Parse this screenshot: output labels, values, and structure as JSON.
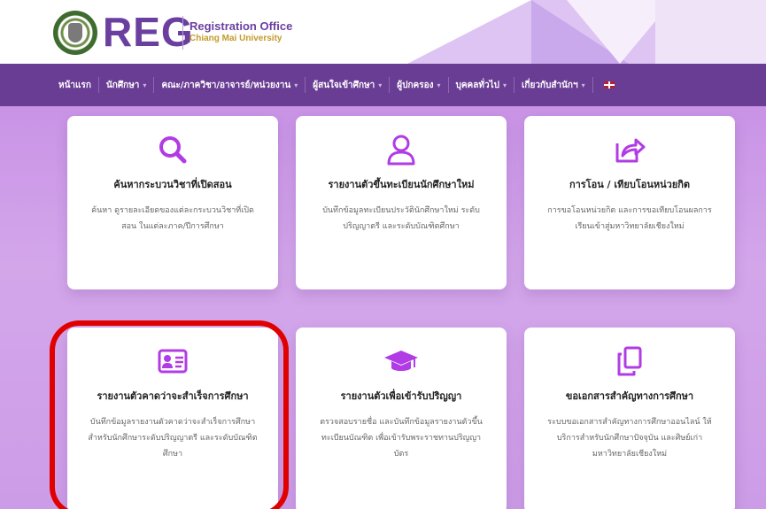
{
  "brand": {
    "logo_text": "REG",
    "subtitle1": "Registration Office",
    "subtitle2": "Chiang Mai University"
  },
  "nav": {
    "items": [
      {
        "label": "หน้าแรก",
        "has_caret": false
      },
      {
        "label": "นักศึกษา",
        "has_caret": true
      },
      {
        "label": "คณะ/ภาควิชา/อาจารย์/หน่วยงาน",
        "has_caret": true
      },
      {
        "label": "ผู้สนใจเข้าศึกษา",
        "has_caret": true
      },
      {
        "label": "ผู้ปกครอง",
        "has_caret": true
      },
      {
        "label": "บุคคลทั่วไป",
        "has_caret": true
      },
      {
        "label": "เกี่ยวกับสำนักฯ",
        "has_caret": true
      }
    ],
    "caret_glyph": "▾",
    "language_icon": "uk-flag-icon"
  },
  "cards": [
    {
      "icon": "search-icon",
      "title": "ค้นหากระบวนวิชาที่เปิดสอน",
      "desc": "ค้นหา ดูรายละเอียดของแต่ละกระบวนวิชาที่เปิดสอน ในแต่ละภาค/ปีการศึกษา"
    },
    {
      "icon": "user-icon",
      "title": "รายงานตัวขึ้นทะเบียนนักศึกษาใหม่",
      "desc": "บันทึกข้อมูลทะเบียนประวัตินักศึกษาใหม่ ระดับปริญญาตรี และระดับบัณฑิตศึกษา"
    },
    {
      "icon": "share-icon",
      "title": "การโอน / เทียบโอนหน่วยกิต",
      "desc": "การขอโอนหน่วยกิต และการขอเทียบโอนผลการเรียนเข้าสู่มหาวิทยาลัยเชียงใหม่"
    },
    {
      "icon": "id-card-icon",
      "title": "รายงานตัวคาดว่าจะสำเร็จการศึกษา",
      "desc": "บันทึกข้อมูลรายงานตัวคาดว่าจะสำเร็จการศึกษา สำหรับนักศึกษาระดับปริญญาตรี และระดับบัณฑิตศึกษา"
    },
    {
      "icon": "graduation-cap-icon",
      "title": "รายงานตัวเพื่อเข้ารับปริญญา",
      "desc": "ตรวจสอบรายชื่อ และบันทึกข้อมูลรายงานตัวขึ้นทะเบียนบัณฑิต เพื่อเข้ารับพระราชทานปริญญาบัตร"
    },
    {
      "icon": "copy-icon",
      "title": "ขอเอกสารสำคัญทางการศึกษา",
      "desc": "ระบบขอเอกสารสำคัญทางการศึกษาออนไลน์ ให้บริการสำหรับนักศึกษาปัจจุบัน และศิษย์เก่า มหาวิทยาลัยเชียงใหม่"
    }
  ],
  "colors": {
    "brand_purple": "#6a3fa0",
    "nav_bg": "#6a3d94",
    "icon_purple": "#b13ce6",
    "highlight_red": "#e00000"
  }
}
